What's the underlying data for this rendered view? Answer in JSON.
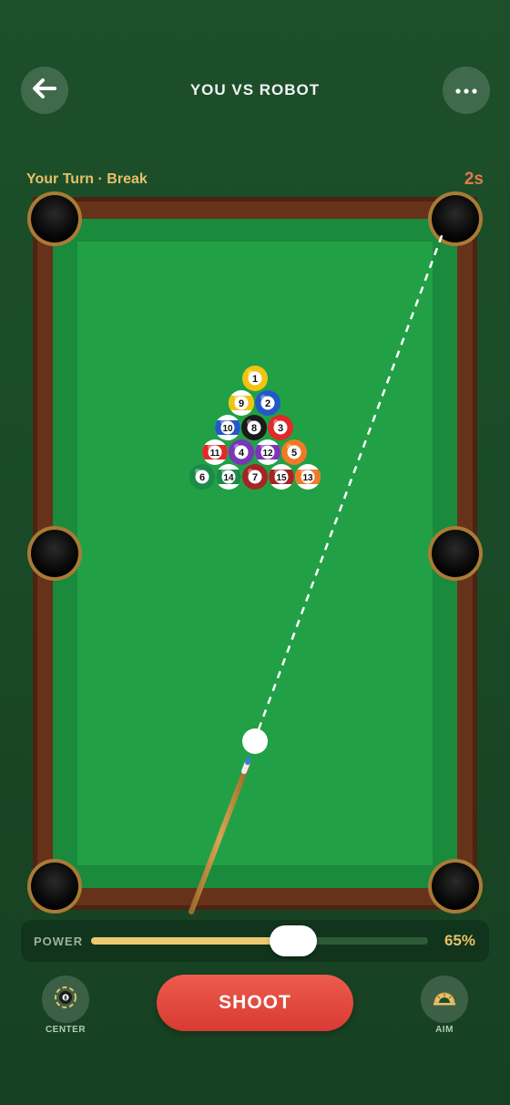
{
  "header": {
    "title": "YOU VS ROBOT",
    "back_icon": "arrow-left-icon",
    "more_icon": "more-dots-icon"
  },
  "status": {
    "turn_text": "Your Turn · Break",
    "timer": "2s"
  },
  "balls": [
    {
      "label": "1",
      "color": "#f1c40f",
      "stripe": false
    },
    {
      "label": "9",
      "color": "#f1c40f",
      "stripe": true
    },
    {
      "label": "2",
      "color": "#2358c9",
      "stripe": false
    },
    {
      "label": "10",
      "color": "#2358c9",
      "stripe": true
    },
    {
      "label": "8",
      "color": "#1a1a1a",
      "stripe": false
    },
    {
      "label": "3",
      "color": "#e02a2a",
      "stripe": false
    },
    {
      "label": "11",
      "color": "#e02a2a",
      "stripe": true
    },
    {
      "label": "4",
      "color": "#7a35b8",
      "stripe": false
    },
    {
      "label": "12",
      "color": "#7a35b8",
      "stripe": true
    },
    {
      "label": "5",
      "color": "#f07a25",
      "stripe": false
    },
    {
      "label": "6",
      "color": "#1c8a48",
      "stripe": false
    },
    {
      "label": "14",
      "color": "#1c8a48",
      "stripe": true
    },
    {
      "label": "7",
      "color": "#a52424",
      "stripe": false
    },
    {
      "label": "15",
      "color": "#a52424",
      "stripe": true
    },
    {
      "label": "13",
      "color": "#f07a25",
      "stripe": true
    }
  ],
  "controls": {
    "power_label": "POWER",
    "power_value": "65%",
    "power_fraction": 0.6,
    "shoot_label": "SHOOT",
    "center_label": "CENTER",
    "aim_label": "AIM",
    "center_icon": "eight-ball-icon",
    "aim_icon": "protractor-icon"
  },
  "colors": {
    "felt": "#22a046",
    "rail_wood": "#5a2a14",
    "accent_gold": "#e8c068",
    "shoot_red": "#d83a33",
    "timer_orange": "#e5794a"
  }
}
